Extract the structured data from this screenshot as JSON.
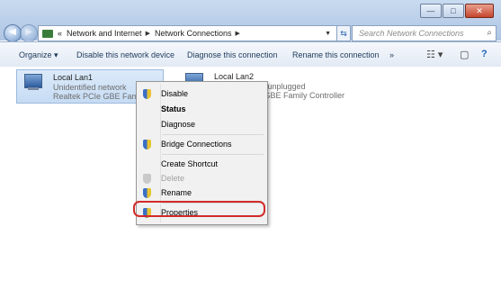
{
  "window": {
    "min_glyph": "—",
    "max_glyph": "□",
    "close_glyph": "✕"
  },
  "nav": {
    "back_glyph": "◀",
    "forward_glyph": "▶"
  },
  "address": {
    "overflow": "«",
    "crumbs": [
      "Network and Internet",
      "Network Connections"
    ],
    "sep_glyph": "▶",
    "dropdown_glyph": "▼"
  },
  "refresh_glyph": "⇆",
  "search": {
    "placeholder": "Search Network Connections",
    "icon_glyph": "⌕"
  },
  "toolbar": {
    "organize": "Organize ▾",
    "disable": "Disable this network device",
    "diagnose": "Diagnose this connection",
    "rename": "Rename this connection",
    "more": "»",
    "view_glyph": "☷ ▾",
    "pane_glyph": "▢",
    "help_glyph": "?"
  },
  "connections": [
    {
      "name": "Local Lan1",
      "status": "Unidentified network",
      "adapter": "Realtek PCIe GBE Family C"
    },
    {
      "name": "Local Lan2",
      "status": "Network cable unplugged",
      "adapter": "Realtek PCIe GBE Family Controller"
    }
  ],
  "context_menu": {
    "disable": "Disable",
    "status": "Status",
    "diagnose": "Diagnose",
    "bridge": "Bridge Connections",
    "shortcut": "Create Shortcut",
    "delete": "Delete",
    "rename": "Rename",
    "properties": "Properties"
  },
  "colors": {
    "highlight_outline": "#d22b2b",
    "selection": "#c6dcf4"
  }
}
